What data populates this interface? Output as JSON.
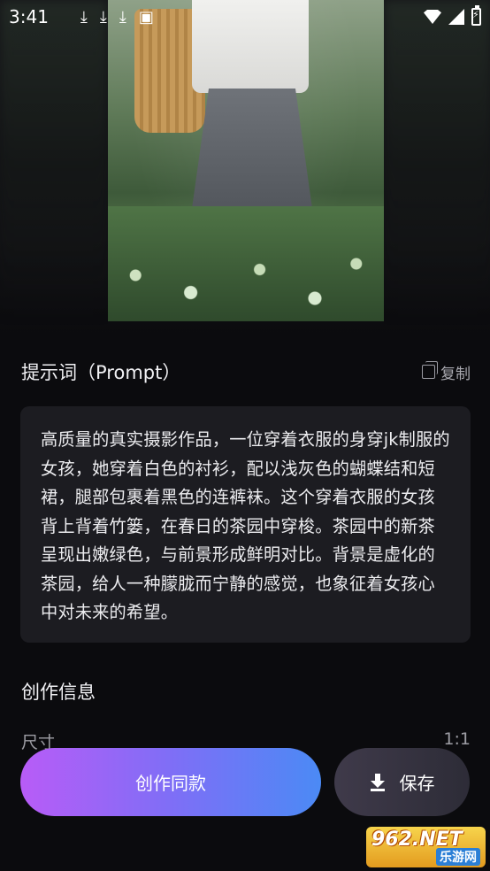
{
  "status_bar": {
    "time": "3:41",
    "notification_icons": [
      "download-icon",
      "download-icon",
      "download-icon",
      "image-icon"
    ],
    "right_icons": [
      "wifi-icon",
      "cell-signal-icon",
      "battery-charging-icon"
    ]
  },
  "prompt": {
    "title": "提示词（Prompt）",
    "copy_label": "复制",
    "text": "高质量的真实摄影作品，一位穿着衣服的身穿jk制服的女孩，她穿着白色的衬衫，配以浅灰色的蝴蝶结和短裙，腿部包裹着黑色的连裤袜。这个穿着衣服的女孩背上背着竹篓，在春日的茶园中穿梭。茶园中的新茶呈现出嫩绿色，与前景形成鲜明对比。背景是虚化的茶园，给人一种朦胧而宁静的感觉，也象征着女孩心中对未来的希望。"
  },
  "creation_info": {
    "title": "创作信息",
    "size_label": "尺寸",
    "size_value": "1:1"
  },
  "actions": {
    "create_label": "创作同款",
    "save_label": "保存"
  },
  "watermark": {
    "top": "962.NET",
    "bottom": "乐游网"
  },
  "colors": {
    "background": "#0b0b0e",
    "card": "#1c1c21",
    "create_gradient_start": "#b85cf7",
    "create_gradient_end": "#4b8af5"
  }
}
